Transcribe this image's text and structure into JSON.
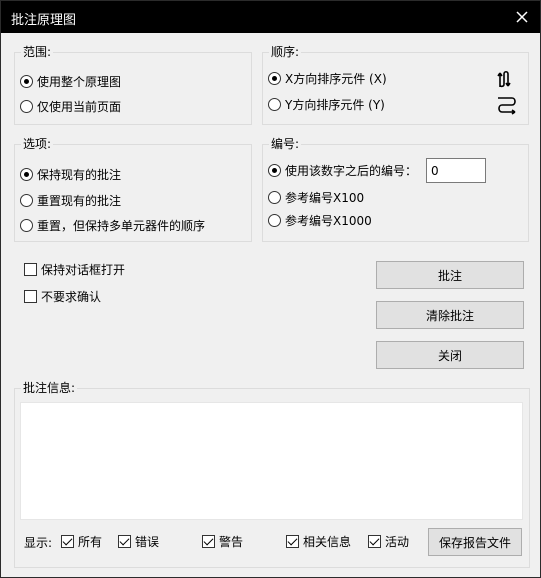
{
  "window": {
    "title": "批注原理图"
  },
  "scope": {
    "legend": "范围:",
    "options": [
      "使用整个原理图",
      "仅使用当前页面"
    ],
    "selected": 0
  },
  "order": {
    "legend": "顺序:",
    "options": [
      "X方向排序元件 (X)",
      "Y方向排序元件 (Y)"
    ],
    "selected": 0
  },
  "options": {
    "legend": "选项:",
    "items": [
      "保持现有的批注",
      "重置现有的批注",
      "重置，但保持多单元器件的顺序"
    ],
    "selected": 0
  },
  "numbering": {
    "legend": "编号:",
    "items": [
      "使用该数字之后的编号：",
      "参考编号X100",
      "参考编号X1000"
    ],
    "selected": 0,
    "start_value": "0"
  },
  "checks": {
    "keep_open": "保持对话框打开",
    "no_confirm": "不要求确认"
  },
  "buttons": {
    "annotate": "批注",
    "clear": "清除批注",
    "close": "关闭",
    "save_report": "保存报告文件"
  },
  "info": {
    "legend": "批注信息:",
    "show_label": "显示:",
    "filters": [
      "所有",
      "错误",
      "警告",
      "相关信息",
      "活动"
    ]
  }
}
